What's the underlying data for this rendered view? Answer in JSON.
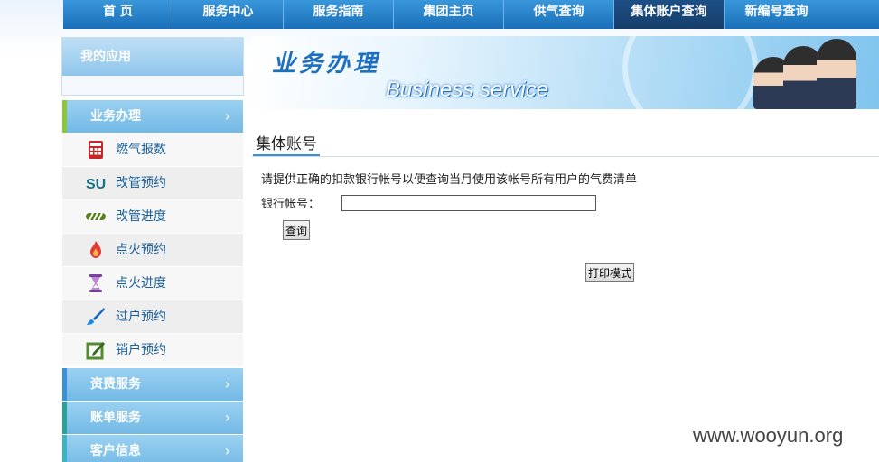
{
  "nav": {
    "items": [
      "首 页",
      "服务中心",
      "服务指南",
      "集团主页",
      "供气查询",
      "集体账户查询",
      "新编号查询"
    ],
    "active_index": 5
  },
  "sidebar": {
    "my_apps_title": "我的应用",
    "section_business": "业务办理",
    "business_items": [
      {
        "label": "燃气报数",
        "icon": "calculator-icon"
      },
      {
        "label": "改管预约",
        "icon": "stumbleupon-icon"
      },
      {
        "label": "改管进度",
        "icon": "progress-bar-icon"
      },
      {
        "label": "点火预约",
        "icon": "flame-icon"
      },
      {
        "label": "点火进度",
        "icon": "hourglass-icon"
      },
      {
        "label": "过户预约",
        "icon": "brush-icon"
      },
      {
        "label": "销户预约",
        "icon": "edit-icon"
      }
    ],
    "section_billing": "资费服务",
    "section_bill": "账单服务",
    "section_customer": "客户信息",
    "chevron": "›"
  },
  "banner": {
    "title_cn": "业务办理",
    "title_en": "Business service"
  },
  "content": {
    "title": "集体账号",
    "description": "请提供正确的扣款银行帐号以便查询当月使用该帐号所有用户的气费清单",
    "account_label": "银行帐号：",
    "account_value": "",
    "query_button": "查询",
    "print_button": "打印模式"
  },
  "watermark": "www.wooyun.org",
  "colors": {
    "nav_bg": "#1a6fb8",
    "nav_active": "#163e6a",
    "sidebar_head": "#72b9e6",
    "accent_green": "#8cc63f",
    "link_blue": "#1a5f9a"
  }
}
